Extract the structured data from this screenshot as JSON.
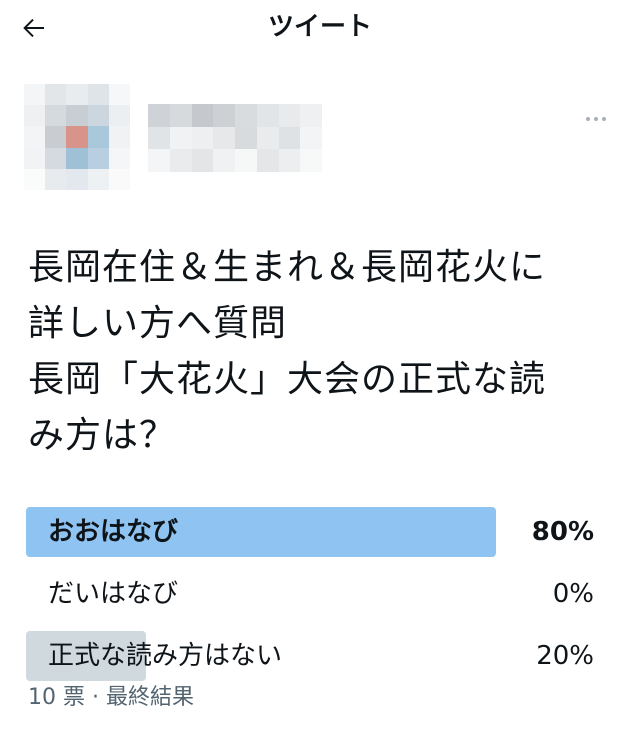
{
  "header": {
    "title": "ツイート",
    "back_icon": "arrow-left-icon"
  },
  "author": {
    "avatar_icon": "pixelated-avatar",
    "more_icon": "more-horizontal-icon"
  },
  "tweet": {
    "lines": [
      "長岡在住＆生まれ＆長岡花火に",
      "詳しい方へ質問",
      "長岡「大花火」大会の正式な読",
      "み方は？"
    ]
  },
  "poll": {
    "options": [
      {
        "label": "おおはなび",
        "percent_text": "80%",
        "percent": 80,
        "winner": true
      },
      {
        "label": "だいはなび",
        "percent_text": "0%",
        "percent": 0,
        "winner": false
      },
      {
        "label": "正式な読み方はない",
        "percent_text": "20%",
        "percent": 20,
        "winner": false
      }
    ],
    "meta": "10 票 · 最終結果"
  },
  "colors": {
    "winner_bar": "#8ec3f2",
    "other_bar": "#cfd9de",
    "meta_text": "#536471"
  }
}
